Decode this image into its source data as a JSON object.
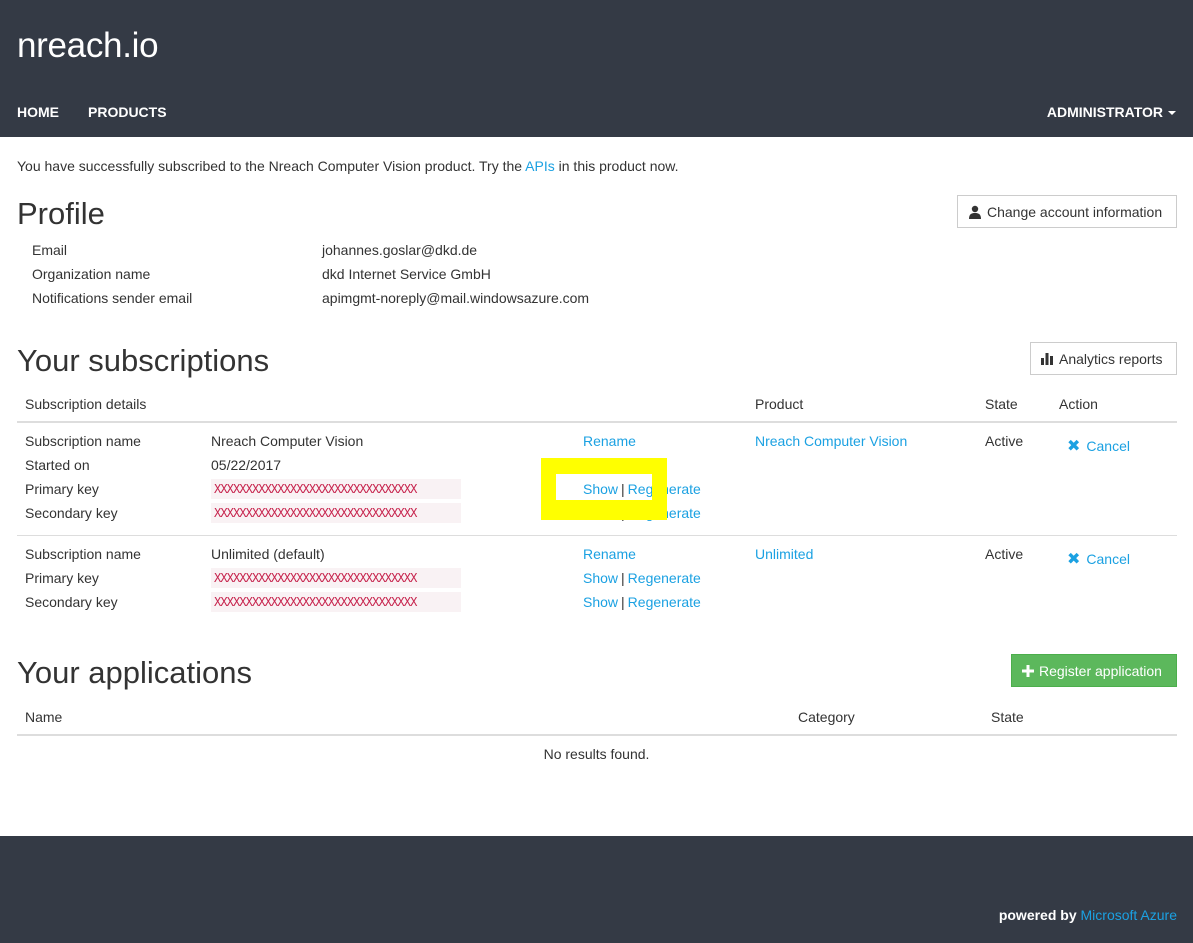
{
  "header": {
    "brand": "nreach.io",
    "nav": {
      "home": "HOME",
      "products": "PRODUCTS",
      "admin": "ADMINISTRATOR"
    }
  },
  "notice": {
    "prefix": "You have successfully subscribed to the Nreach Computer Vision product. Try the ",
    "link": "APIs",
    "suffix": " in this product now."
  },
  "profile": {
    "title": "Profile",
    "change_button": "Change account information",
    "rows": [
      {
        "label": "Email",
        "value": "johannes.goslar@dkd.de"
      },
      {
        "label": "Organization name",
        "value": "dkd Internet Service GmbH"
      },
      {
        "label": "Notifications sender email",
        "value": "apimgmt-noreply@mail.windowsazure.com"
      }
    ]
  },
  "subscriptions": {
    "title": "Your subscriptions",
    "analytics_button": "Analytics reports",
    "headers": {
      "details": "Subscription details",
      "product": "Product",
      "state": "State",
      "action": "Action"
    },
    "items": [
      {
        "name_label": "Subscription name",
        "name": "Nreach Computer Vision",
        "rename": "Rename",
        "started_label": "Started on",
        "started": "05/22/2017",
        "primary_label": "Primary key",
        "primary": "XXXXXXXXXXXXXXXXXXXXXXXXXXXXXXXX",
        "secondary_label": "Secondary key",
        "secondary": "XXXXXXXXXXXXXXXXXXXXXXXXXXXXXXXX",
        "show": "Show",
        "regenerate": "Regenerate",
        "product": "Nreach Computer Vision",
        "state": "Active",
        "cancel": "Cancel"
      },
      {
        "name_label": "Subscription name",
        "name": "Unlimited (default)",
        "rename": "Rename",
        "primary_label": "Primary key",
        "primary": "XXXXXXXXXXXXXXXXXXXXXXXXXXXXXXXX",
        "secondary_label": "Secondary key",
        "secondary": "XXXXXXXXXXXXXXXXXXXXXXXXXXXXXXXX",
        "show": "Show",
        "regenerate": "Regenerate",
        "product": "Unlimited",
        "state": "Active",
        "cancel": "Cancel"
      }
    ]
  },
  "applications": {
    "title": "Your applications",
    "register_button": "Register application",
    "headers": {
      "name": "Name",
      "category": "Category",
      "state": "State"
    },
    "empty": "No results found."
  },
  "footer": {
    "prefix": "powered by ",
    "link": "Microsoft Azure"
  },
  "colors": {
    "header_bg": "#343a45",
    "link": "#1ba1e2",
    "green": "#5cb85c",
    "highlight": "#ffff00",
    "key_text": "#c7254e"
  }
}
